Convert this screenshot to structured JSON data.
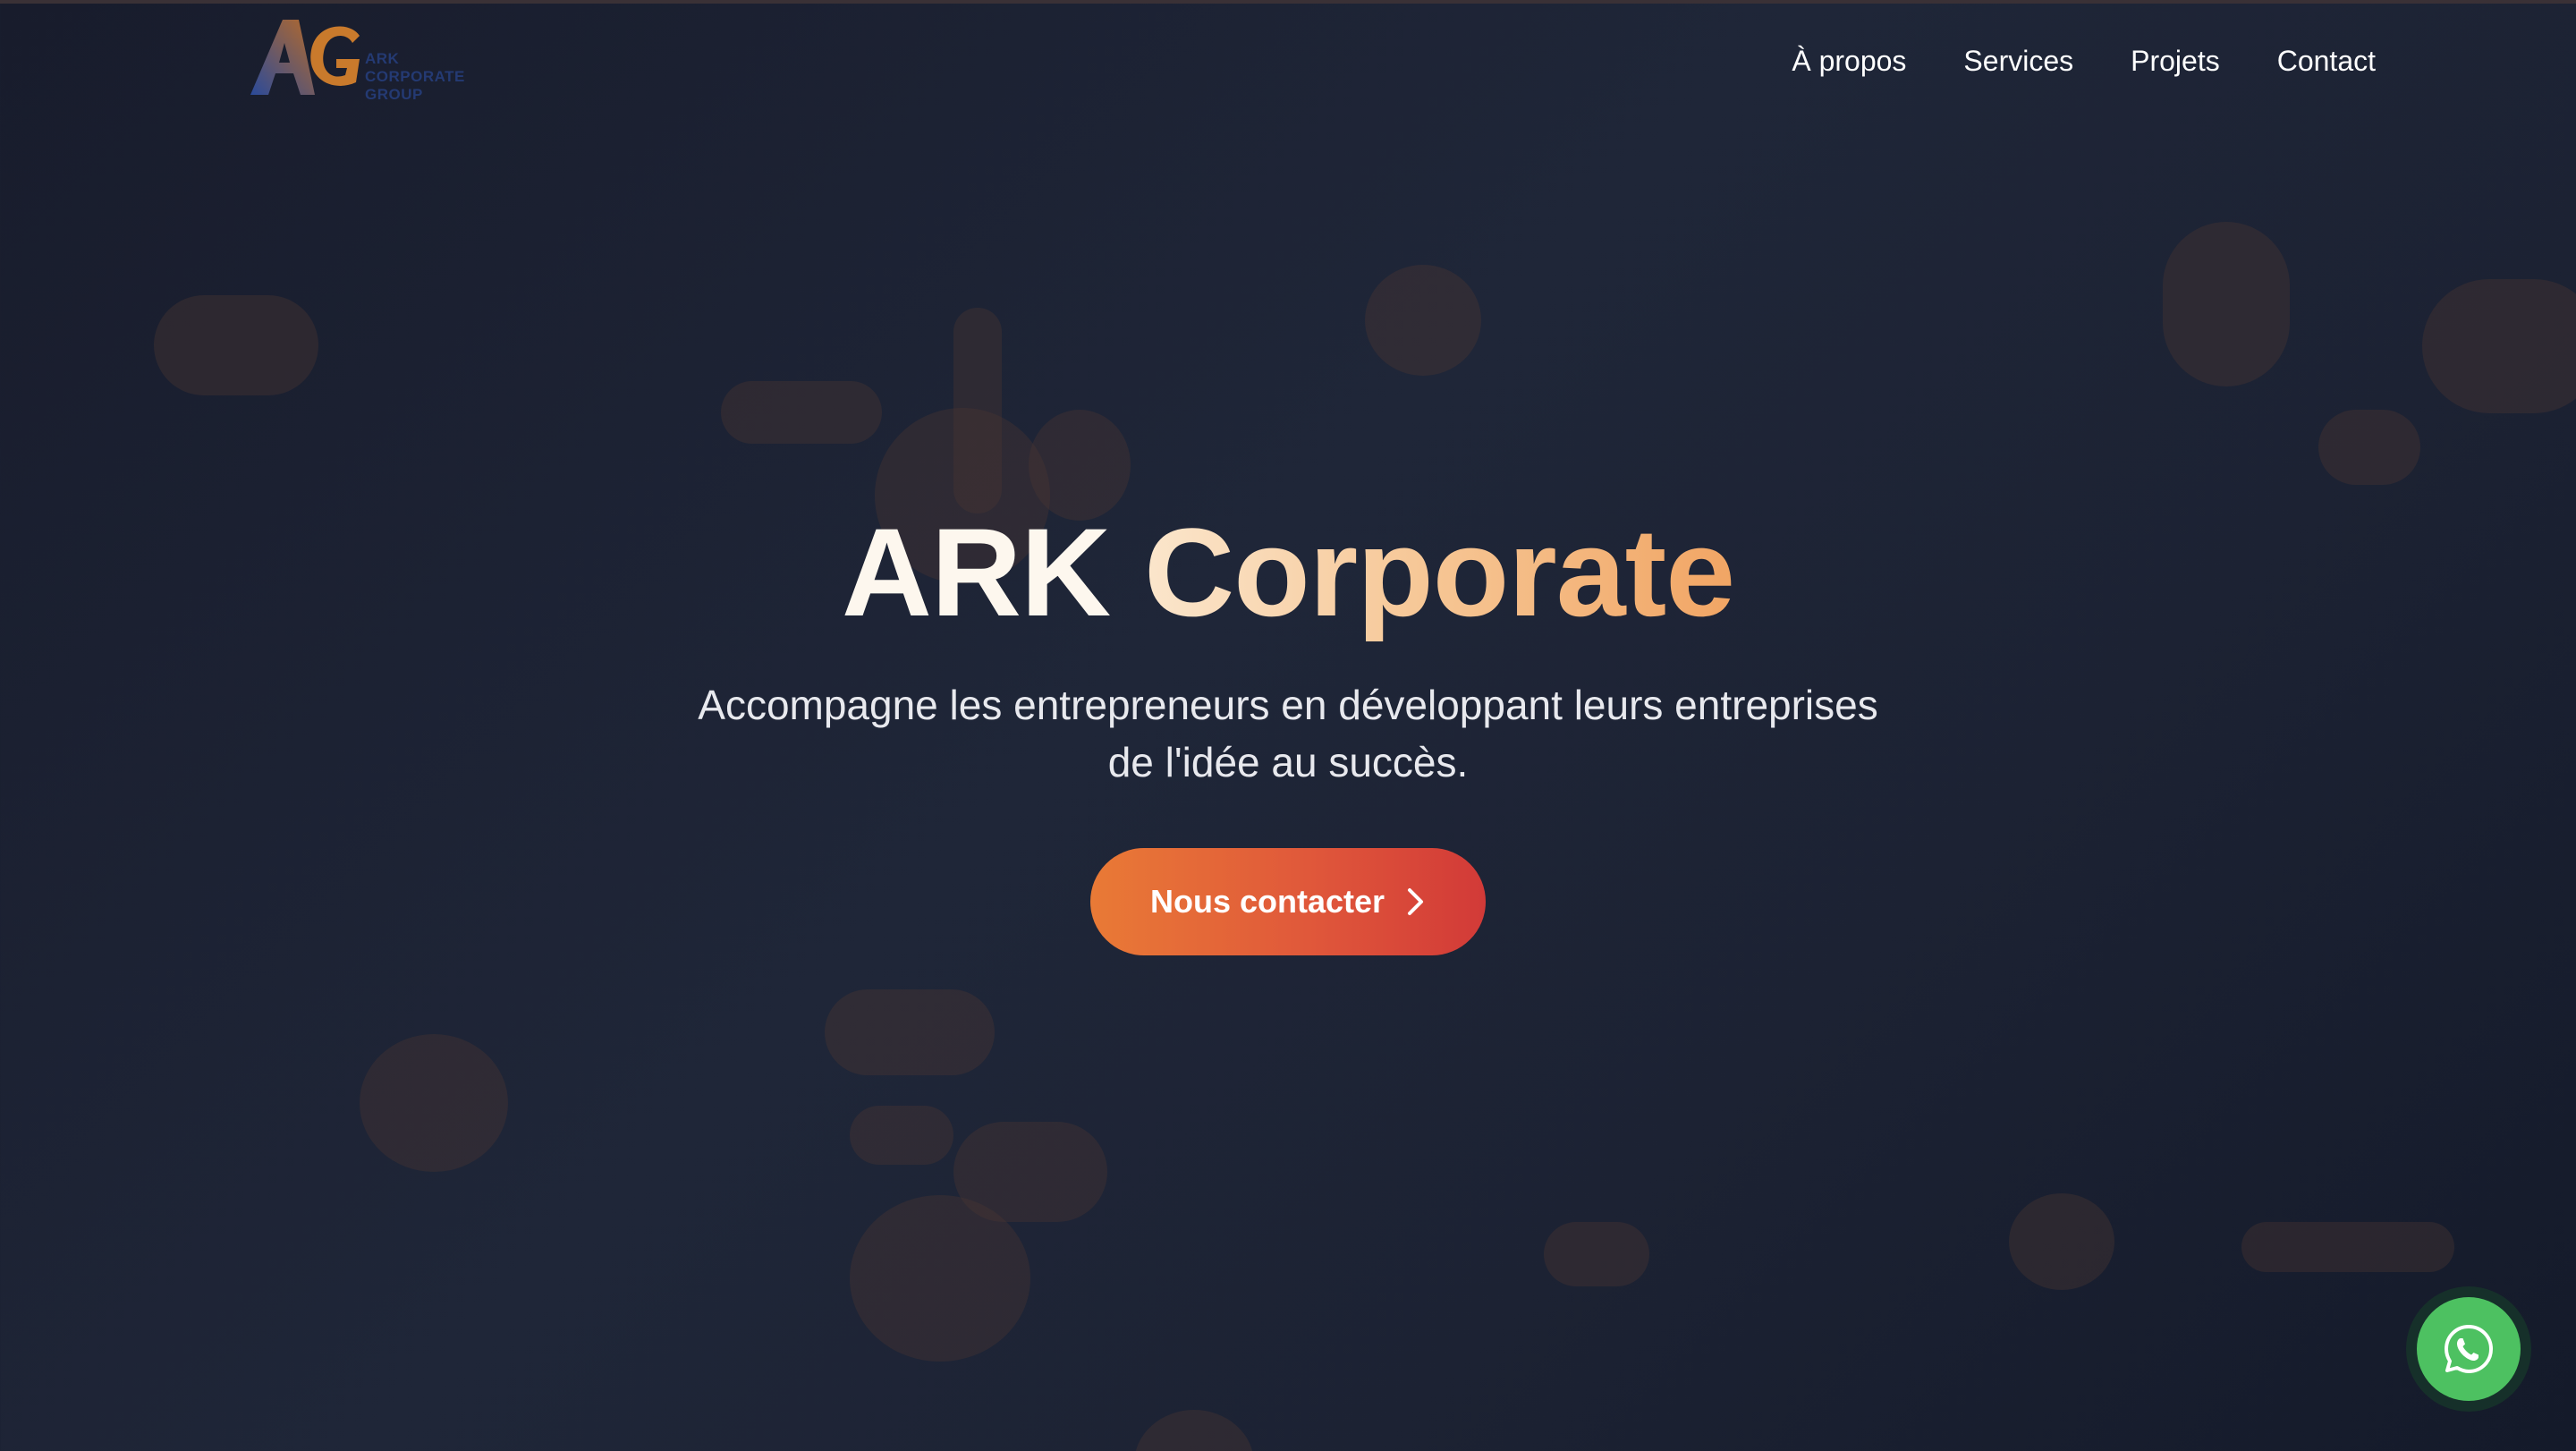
{
  "brand": {
    "logo_letters": "AG",
    "logo_text": [
      "ARK",
      "CORPORATE",
      "GROUP"
    ]
  },
  "nav": {
    "items": [
      {
        "label": "À propos"
      },
      {
        "label": "Services"
      },
      {
        "label": "Projets"
      },
      {
        "label": "Contact"
      }
    ]
  },
  "hero": {
    "title_part1": "ARK",
    "title_part2": "Corporate",
    "subtitle_line1": "Accompagne les entrepreneurs en développant leurs entreprises",
    "subtitle_line2": "de l'idée au succès.",
    "cta_label": "Nous contacter",
    "cta_icon": "chevron-right-icon"
  },
  "floating": {
    "whatsapp_icon": "whatsapp-icon"
  },
  "colors": {
    "background": "#1f2638",
    "accent_orange": "#e97a36",
    "accent_red": "#d23a38",
    "whatsapp_green": "#4dc161"
  }
}
